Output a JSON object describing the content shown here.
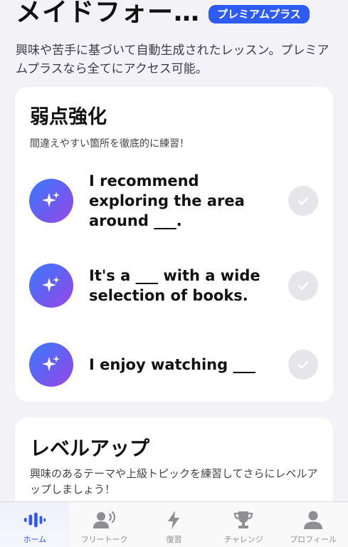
{
  "header": {
    "title": "メイドフォー…",
    "badge": "プレミアムプラス",
    "subtitle": "興味や苦手に基づいて自動生成されたレッスン。プレミアムプラスなら全てにアクセス可能。"
  },
  "weak_points": {
    "title": "弱点強化",
    "description": "間違えやすい箇所を徹底的に練習！",
    "lessons": [
      {
        "text": "I recommend exploring the area around ___.",
        "icon": "sparkle-icon",
        "status_icon": "checkmark-icon"
      },
      {
        "text": "It's a ___ with a wide selection of books.",
        "icon": "sparkle-icon",
        "status_icon": "checkmark-icon"
      },
      {
        "text": "I enjoy watching ___",
        "icon": "sparkle-icon",
        "status_icon": "checkmark-icon"
      }
    ]
  },
  "level_up": {
    "title": "レベルアップ",
    "description": "興味のあるテーマや上級トピックを練習してさらにレベルアップしましょう！"
  },
  "tabbar": {
    "tabs": [
      {
        "label": "ホーム",
        "icon": "waveform-icon",
        "active": true
      },
      {
        "label": "フリートーク",
        "icon": "person-speaking-icon",
        "active": false
      },
      {
        "label": "復習",
        "icon": "bolt-icon",
        "active": false
      },
      {
        "label": "チャレンジ",
        "icon": "trophy-icon",
        "active": false
      },
      {
        "label": "プロフィール",
        "icon": "person-icon",
        "active": false
      }
    ]
  },
  "colors": {
    "accent": "#2f5bf5",
    "background": "#f2f2f7",
    "inactive": "#8e8e93",
    "check_bg": "#e5e5ea"
  }
}
